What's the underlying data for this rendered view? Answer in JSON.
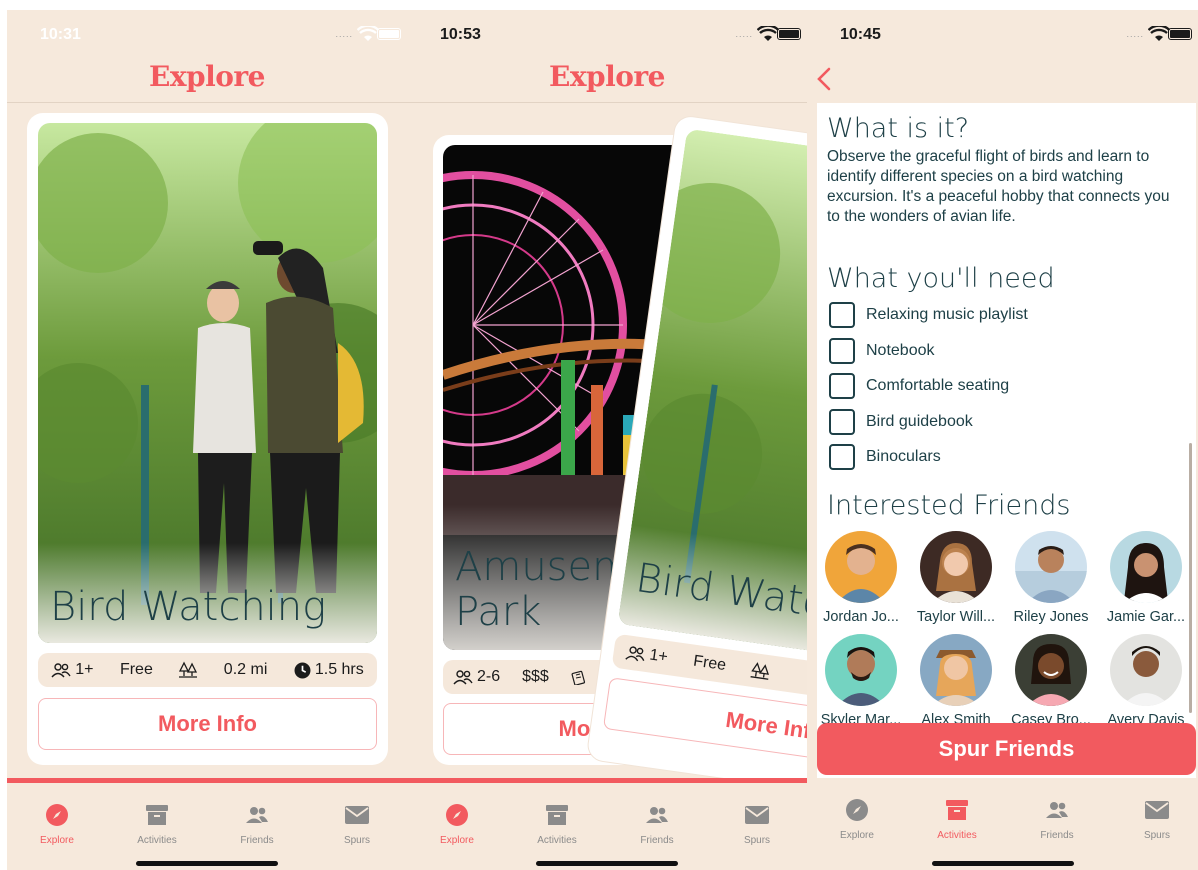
{
  "screens": [
    {
      "time": "10:31",
      "title": "Explore",
      "card": {
        "title": "Bird Watching",
        "stats": {
          "group": "1+",
          "price": "Free",
          "distance": "0.2 mi",
          "duration": "1.5 hrs"
        },
        "button": "More Info"
      }
    },
    {
      "time": "10:53",
      "title": "Explore",
      "back_card": {
        "title": "Amusement Park",
        "stats": {
          "group": "2-6",
          "price": "$$$"
        },
        "button": "More Info"
      },
      "front_card": {
        "title": "Bird Watching",
        "stats": {
          "group": "1+",
          "price": "Free"
        },
        "button": "More Info"
      }
    },
    {
      "time": "10:45",
      "what_heading": "What is it?",
      "description": "Observe the graceful flight of birds and learn to identify different species on a bird watching excursion. It's a peaceful hobby that connects you to the wonders of avian life.",
      "need_heading": "What you'll need",
      "needs": [
        "Relaxing music playlist",
        "Notebook",
        "Comfortable seating",
        "Bird guidebook",
        "Binoculars"
      ],
      "friends_heading": "Interested Friends",
      "friends": [
        "Jordan Jo...",
        "Taylor Will...",
        "Riley Jones",
        "Jamie Gar...",
        "Skyler Mar...",
        "Alex Smith",
        "Casey Bro...",
        "Avery Davis"
      ],
      "spur_button": "Spur Friends"
    }
  ],
  "tabs": [
    "Explore",
    "Activities",
    "Friends",
    "Spurs"
  ],
  "colors": {
    "accent": "#f25a5f",
    "background": "#f6e9dc",
    "text": "#1e4047",
    "tab_inactive": "#8b8b8b"
  },
  "icons": [
    "compass-icon",
    "archive-box-icon",
    "people-icon",
    "envelope-icon",
    "wifi-icon",
    "battery-icon",
    "chevron-left-icon",
    "group-icon",
    "trees-icon",
    "clock-icon",
    "tickets-icon"
  ]
}
